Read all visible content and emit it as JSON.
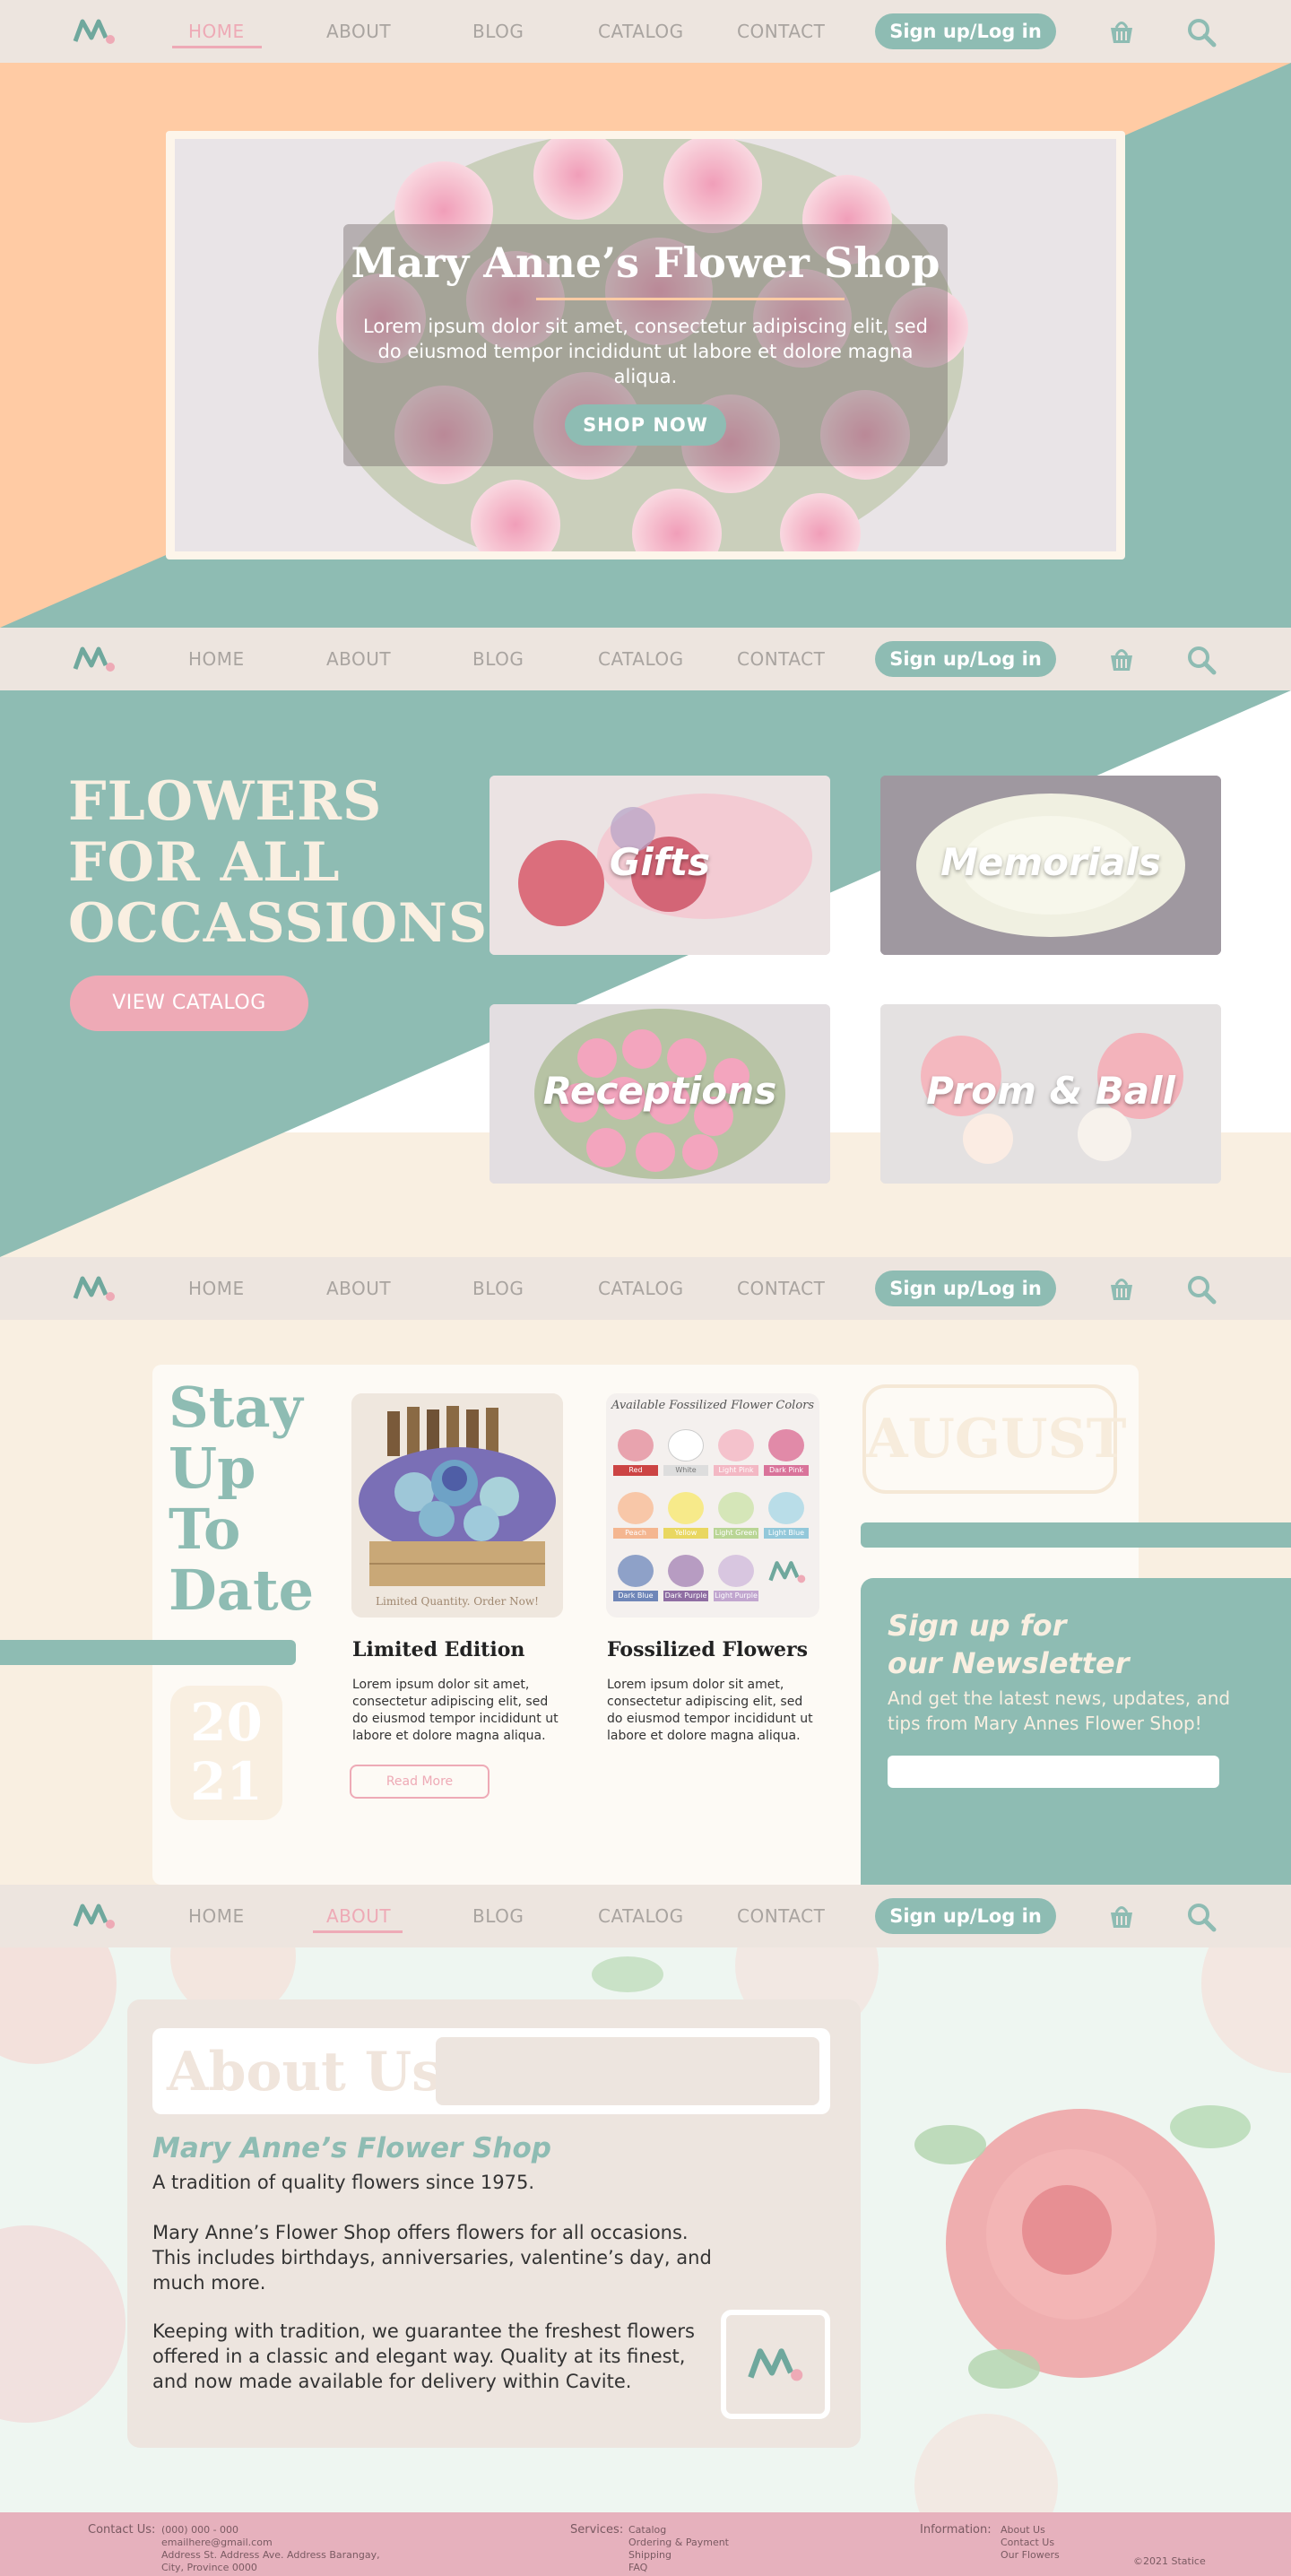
{
  "nav": {
    "items": [
      "HOME",
      "ABOUT",
      "BLOG",
      "CATALOG",
      "CONTACT"
    ],
    "signup_label": "Sign up/Log in"
  },
  "hero": {
    "title": "Mary Anne’s Flower Shop",
    "text": "Lorem ipsum dolor sit amet, consectetur adipiscing elit, sed do eiusmod tempor incididunt ut labore et dolore magna aliqua.",
    "button": "SHOP NOW"
  },
  "occasions": {
    "heading_lines": [
      "FLOWERS",
      "FOR ALL",
      "OCCASSIONS"
    ],
    "button": "VIEW CATALOG",
    "cards": [
      "Gifts",
      "Memorials",
      "Receptions",
      "Prom & Ball"
    ]
  },
  "updates": {
    "heading_lines": [
      "Stay",
      "Up",
      "To",
      "Date"
    ],
    "year_lines": [
      "20",
      "21"
    ],
    "month": "AUGUST",
    "posts": [
      {
        "title": "Limited Edition",
        "text": "Lorem ipsum dolor sit amet, consectetur adipiscing elit, sed do eiusmod tempor incididunt ut labore et dolore magna aliqua.",
        "image_caption": "Limited Quantity. Order Now!"
      },
      {
        "title": "Fossilized Flowers",
        "text": "Lorem ipsum dolor sit amet, consectetur adipiscing elit, sed do eiusmod tempor incididunt ut labore et dolore magna aliqua.",
        "image_title": "Available Fossilized Flower Colors",
        "swatches": [
          "Red",
          "White",
          "Light Pink",
          "Dark Pink",
          "Peach",
          "Yellow",
          "Light Green",
          "Light Blue",
          "Dark Blue",
          "Dark Purple",
          "Light Purple"
        ]
      }
    ],
    "read_more": "Read More",
    "newsletter": {
      "title_lines": [
        "Sign up for",
        "our Newsletter"
      ],
      "text": "And get the latest news, updates, and tips from Mary Annes Flower Shop!"
    }
  },
  "about": {
    "heading": "About Us",
    "shop_name": "Mary Anne’s Flower Shop",
    "tagline": "A tradition of quality flowers since 1975.",
    "para1": "Mary Anne’s Flower Shop offers flowers for all occasions. This includes birthdays, anniversaries, valentine’s day, and much more.",
    "para2": "Keeping with tradition, we guarantee the freshest flowers offered in a classic and elegant way. Quality at its finest, and now made available for delivery within Cavite."
  },
  "footer": {
    "contact_label": "Contact Us:",
    "contact_lines": [
      "(000) 000 - 000",
      "emailhere@gmail.com",
      "Address St. Address Ave. Address Barangay,",
      "City, Province 0000"
    ],
    "services_label": "Services:",
    "services": [
      "Catalog",
      "Ordering & Payment",
      "Shipping",
      "FAQ"
    ],
    "info_label": "Information:",
    "info": [
      "About Us",
      "Contact Us",
      "Our Flowers"
    ],
    "copyright": "©2021 Statice"
  },
  "colors": {
    "teal": "#8ebcb3",
    "peach": "#ffcba4",
    "cream": "#f9efe1",
    "pink": "#eeaab6",
    "nav_bg": "#ede5df"
  }
}
